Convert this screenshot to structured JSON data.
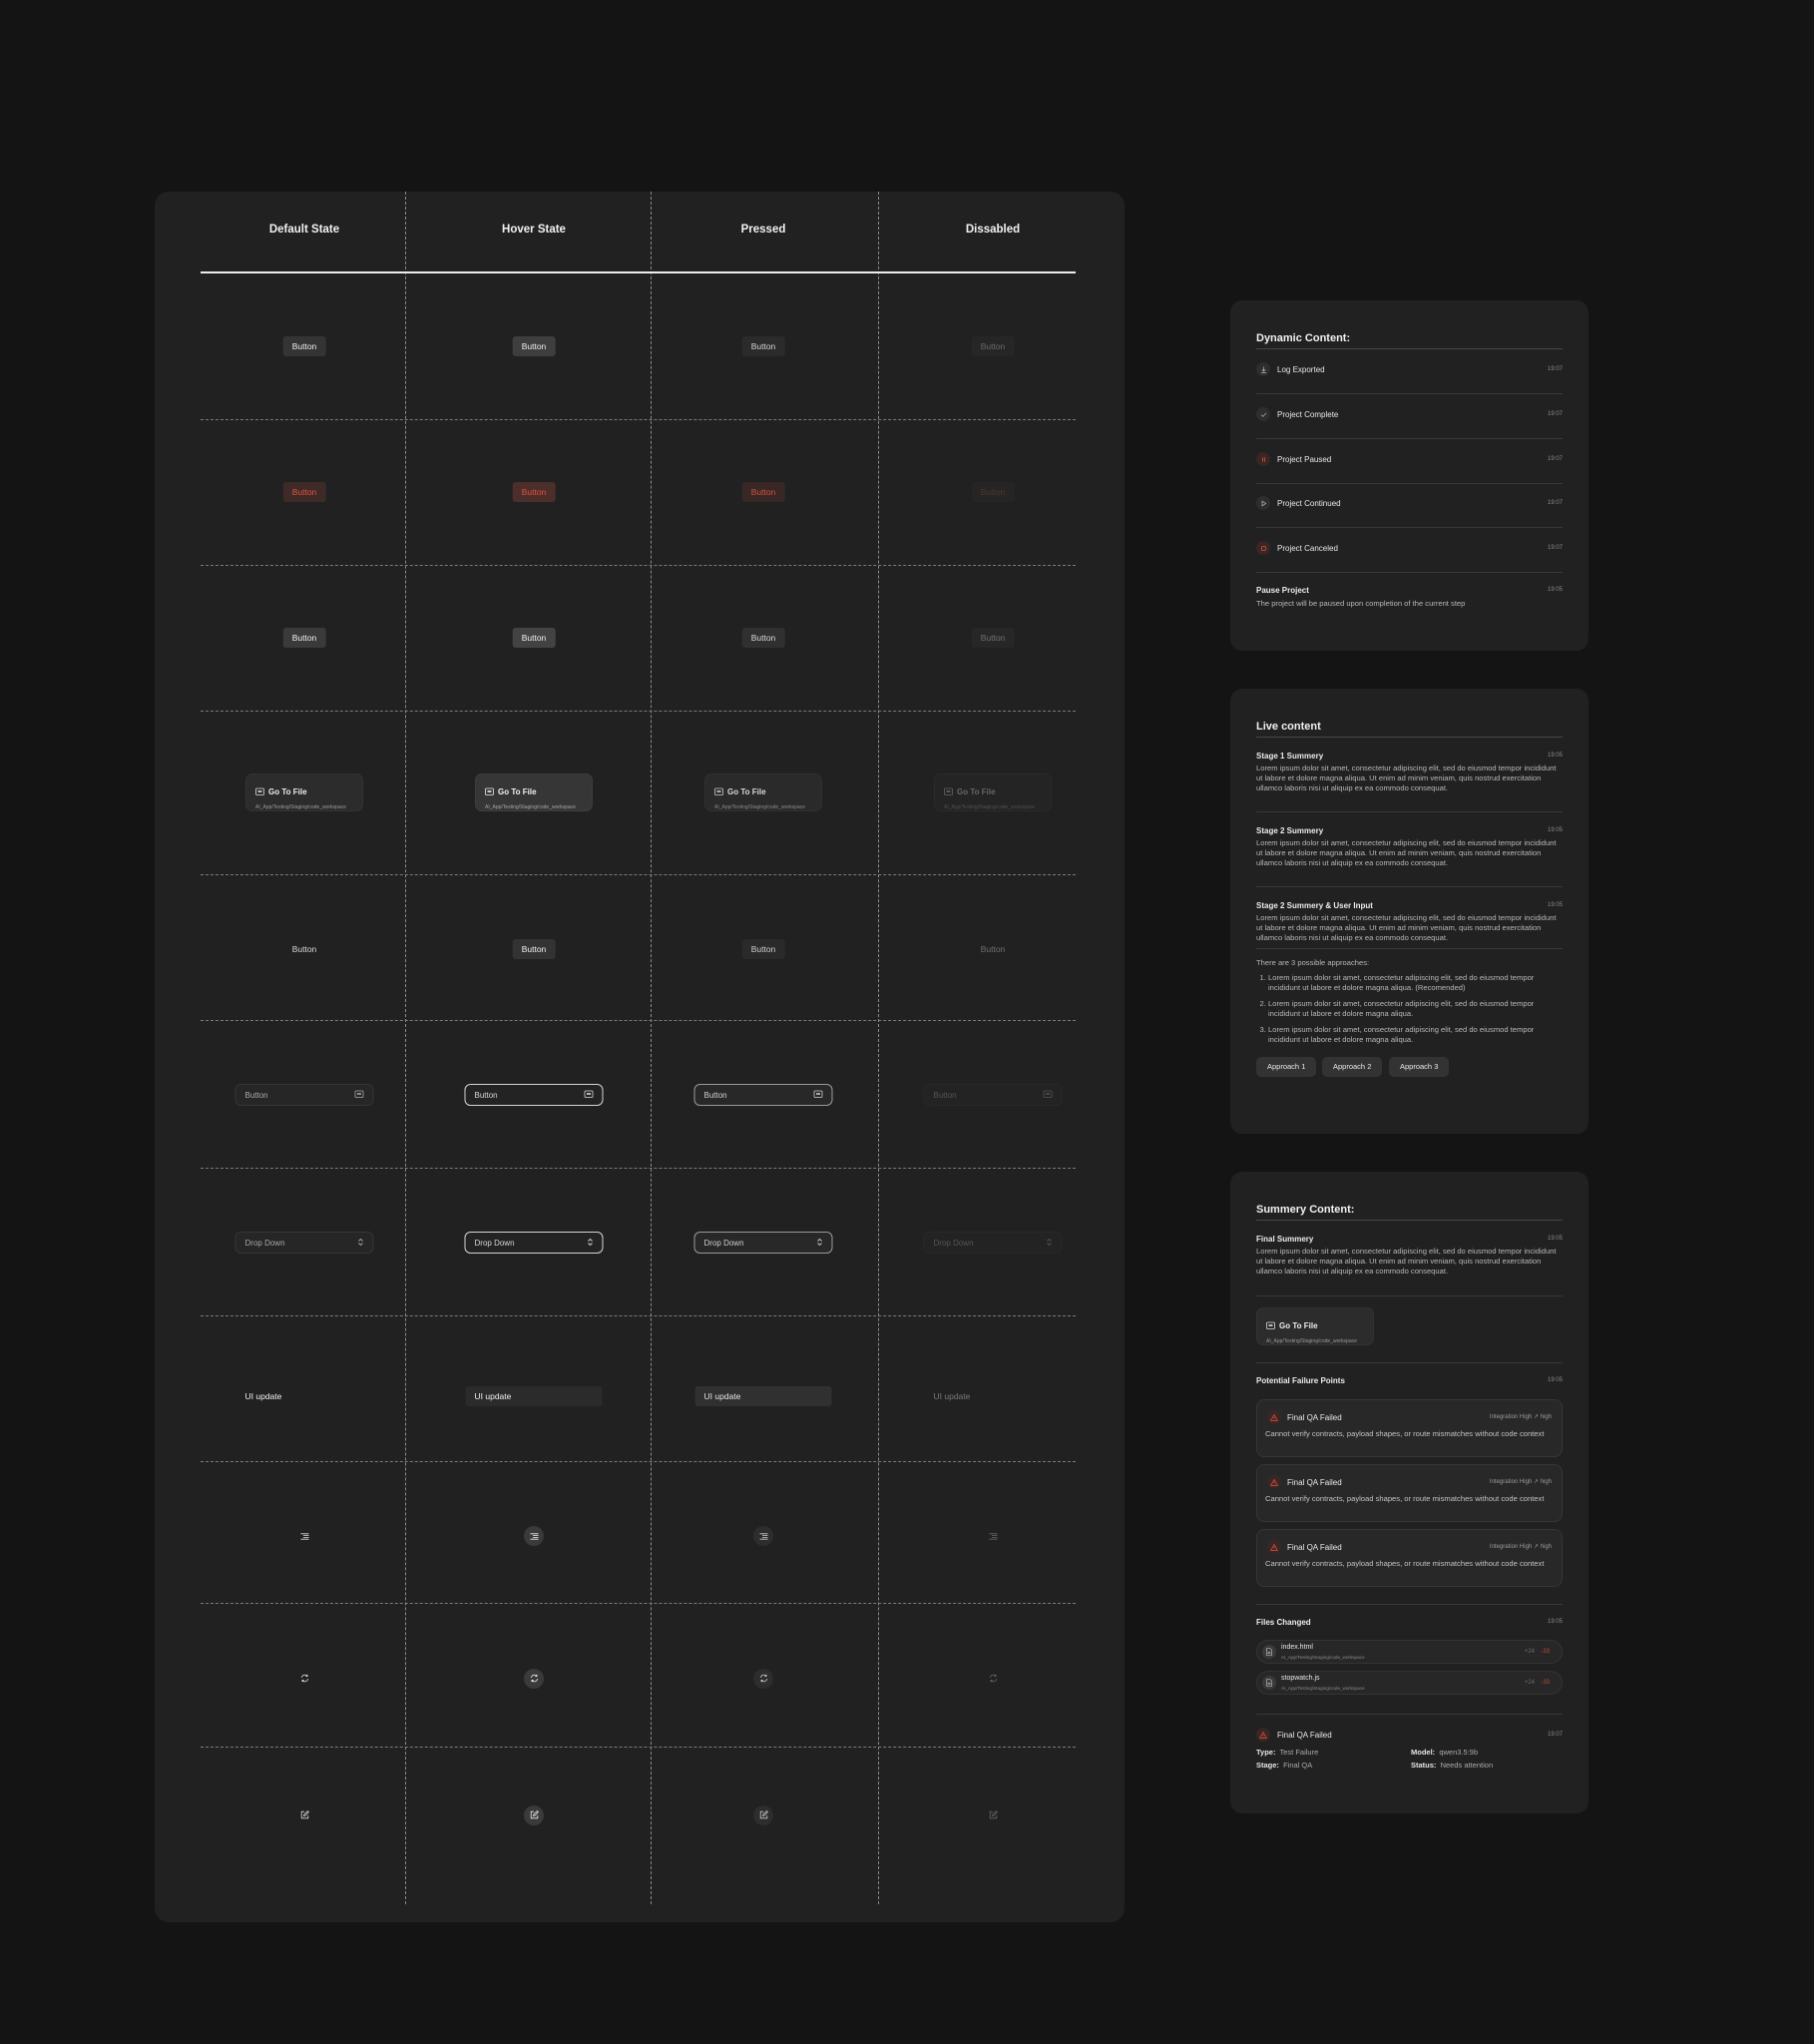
{
  "states_table": {
    "columns": [
      "Default State",
      "Hover State",
      "Pressed",
      "Dissabled"
    ],
    "button_label": "Button",
    "go_to_file": {
      "title": "Go To File",
      "path": "AI_App/Testing/Staging/code_workspace"
    },
    "input_label": "Button",
    "dropdown_label": "Drop Down",
    "ui_update_label": "UI update"
  },
  "dynamic_card": {
    "title": "Dynamic Content:",
    "events": [
      {
        "label": "Log Exported",
        "time": "19:07",
        "icon": "download-icon"
      },
      {
        "label": "Project Complete",
        "time": "19:07",
        "icon": "check-icon"
      },
      {
        "label": "Project Paused",
        "time": "19:07",
        "icon": "pause-icon"
      },
      {
        "label": "Project Continued",
        "time": "19:07",
        "icon": "play-icon"
      },
      {
        "label": "Project Canceled",
        "time": "19:07",
        "icon": "stop-icon"
      }
    ],
    "pause": {
      "title": "Pause Project",
      "time": "19:05",
      "text": "The project will be paused upon completion of the current step"
    }
  },
  "live_card": {
    "title": "Live content",
    "stages": [
      {
        "title": "Stage 1 Summery",
        "time": "19:05",
        "text": "Lorem ipsum dolor sit amet, consectetur adipiscing elit, sed do eiusmod tempor incididunt ut labore et dolore magna aliqua. Ut enim ad minim veniam, quis nostrud exercitation ullamco laboris nisi ut aliquip ex ea commodo consequat."
      },
      {
        "title": "Stage 2 Summery",
        "time": "19:05",
        "text": "Lorem ipsum dolor sit amet, consectetur adipiscing elit, sed do eiusmod tempor incididunt ut labore et dolore magna aliqua. Ut enim ad minim veniam, quis nostrud exercitation ullamco laboris nisi ut aliquip ex ea commodo consequat."
      },
      {
        "title": "Stage 2 Summery & User Input",
        "time": "19:05",
        "text": "Lorem ipsum dolor sit amet, consectetur adipiscing elit, sed do eiusmod tempor incididunt ut labore et dolore magna aliqua. Ut enim ad minim veniam, quis nostrud exercitation ullamco laboris nisi ut aliquip ex ea commodo consequat."
      }
    ],
    "approaches_intro": "There are 3 possible approaches:",
    "approaches": [
      "Lorem ipsum dolor sit amet, consectetur adipiscing elit, sed do eiusmod tempor incididunt ut labore et dolore magna aliqua. (Recomended)",
      "Lorem ipsum dolor sit amet, consectetur adipiscing elit, sed do eiusmod tempor incididunt ut labore et dolore magna aliqua.",
      "Lorem ipsum dolor sit amet, consectetur adipiscing elit, sed do eiusmod tempor incididunt ut labore et dolore magna aliqua."
    ],
    "buttons": [
      "Approach 1",
      "Approach 2",
      "Approach 3"
    ]
  },
  "summary_card": {
    "title": "Summery Content:",
    "final": {
      "title": "Final Summery",
      "time": "19:05",
      "text": "Lorem ipsum dolor sit amet, consectetur adipiscing elit, sed do eiusmod tempor incididunt ut labore et dolore magna aliqua. Ut enim ad minim veniam, quis nostrud exercitation ullamco laboris nisi ut aliquip ex ea commodo consequat."
    },
    "go_to_file": {
      "title": "Go To File",
      "path": "AI_App/Testing/Staging/code_workspace"
    },
    "failure_points": {
      "title": "Potential Failure Points",
      "time": "19:05",
      "items": [
        {
          "title": "Final QA Failed",
          "tag": "Integration High",
          "level": "high",
          "text": "Cannot verify contracts, payload shapes, or route mismatches without code context"
        },
        {
          "title": "Final QA Failed",
          "tag": "Integration High",
          "level": "high",
          "text": "Cannot verify contracts, payload shapes, or route mismatches without code context"
        },
        {
          "title": "Final QA Failed",
          "tag": "Integration High",
          "level": "high",
          "text": "Cannot verify contracts, payload shapes, or route mismatches without code context"
        }
      ]
    },
    "files_changed": {
      "title": "Files Changed",
      "time": "19:05",
      "files": [
        {
          "name": "index.html",
          "path": "AI_App/Testing/Staging/code_workspace",
          "added": "+24",
          "removed": "-33"
        },
        {
          "name": "stopwatch.js",
          "path": "AI_App/Testing/Staging/code_workspace",
          "added": "+24",
          "removed": "-33"
        }
      ]
    },
    "final_qa": {
      "title": "Final QA Failed",
      "time": "19:07",
      "type_label": "Type:",
      "type_value": "Test Failure",
      "stage_label": "Stage:",
      "stage_value": "Final QA",
      "model_label": "Model:",
      "model_value": "qwen3.5:9b",
      "status_label": "Status:",
      "status_value": "Needs attention"
    }
  },
  "colors": {
    "background": "#141414",
    "panel": "#212121",
    "danger": "#e0533e"
  }
}
